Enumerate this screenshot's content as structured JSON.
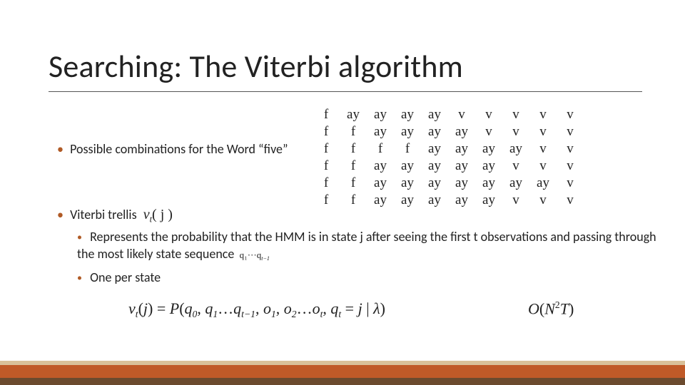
{
  "title": "Searching: The Viterbi algorithm",
  "bullets": {
    "possible": "Possible combinations for the Word “five”",
    "trellis": "Viterbi trellis",
    "desc": "Represents the probability  that the HMM is in state j after seeing the first t observations and passing through the most likely state sequence",
    "one": "One per state"
  },
  "math": {
    "vtj": "v",
    "vtj_sub": "t",
    "vtj_arg": "( j )",
    "qseq": "q₁···q",
    "qseq_tail_sub": "t−1",
    "eq": "v_t(j) = P(q₀, q₁…q_{t−1}, o₁, o₂…o_t, q_t = j | λ)",
    "bigO": "O(N²T)"
  },
  "table": [
    [
      "f",
      "ay",
      "ay",
      "ay",
      "ay",
      "v",
      "v",
      "v",
      "v",
      "v"
    ],
    [
      "f",
      "f",
      "ay",
      "ay",
      "ay",
      "ay",
      "v",
      "v",
      "v",
      "v"
    ],
    [
      "f",
      "f",
      "f",
      "f",
      "ay",
      "ay",
      "ay",
      "ay",
      "v",
      "v"
    ],
    [
      "f",
      "f",
      "ay",
      "ay",
      "ay",
      "ay",
      "ay",
      "v",
      "v",
      "v"
    ],
    [
      "f",
      "f",
      "ay",
      "ay",
      "ay",
      "ay",
      "ay",
      "ay",
      "ay",
      "v"
    ],
    [
      "f",
      "f",
      "ay",
      "ay",
      "ay",
      "ay",
      "ay",
      "v",
      "v",
      "v"
    ]
  ]
}
